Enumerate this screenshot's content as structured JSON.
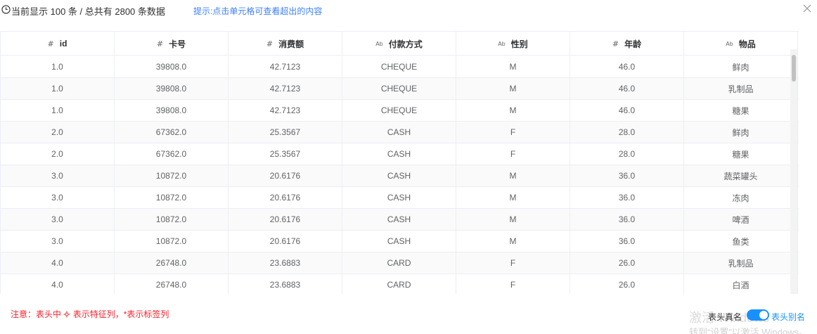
{
  "topbar": {
    "summary": "当前显示 100 条 / 总共有 2800 条数据",
    "hint": "提示:点击单元格可查看超出的内容"
  },
  "table": {
    "columns": [
      {
        "type_icon": "#",
        "label": "id"
      },
      {
        "type_icon": "#",
        "label": "卡号"
      },
      {
        "type_icon": "#",
        "label": "消费额"
      },
      {
        "type_icon": "Ab",
        "label": "付款方式"
      },
      {
        "type_icon": "Ab",
        "label": "性别"
      },
      {
        "type_icon": "#",
        "label": "年龄"
      },
      {
        "type_icon": "Ab",
        "label": "物品"
      }
    ],
    "rows": [
      [
        "1.0",
        "39808.0",
        "42.7123",
        "CHEQUE",
        "M",
        "46.0",
        "鲜肉"
      ],
      [
        "1.0",
        "39808.0",
        "42.7123",
        "CHEQUE",
        "M",
        "46.0",
        "乳制品"
      ],
      [
        "1.0",
        "39808.0",
        "42.7123",
        "CHEQUE",
        "M",
        "46.0",
        "糖果"
      ],
      [
        "2.0",
        "67362.0",
        "25.3567",
        "CASH",
        "F",
        "28.0",
        "鲜肉"
      ],
      [
        "2.0",
        "67362.0",
        "25.3567",
        "CASH",
        "F",
        "28.0",
        "糖果"
      ],
      [
        "3.0",
        "10872.0",
        "20.6176",
        "CASH",
        "M",
        "36.0",
        "蔬菜罐头"
      ],
      [
        "3.0",
        "10872.0",
        "20.6176",
        "CASH",
        "M",
        "36.0",
        "冻肉"
      ],
      [
        "3.0",
        "10872.0",
        "20.6176",
        "CASH",
        "M",
        "36.0",
        "啤酒"
      ],
      [
        "3.0",
        "10872.0",
        "20.6176",
        "CASH",
        "M",
        "36.0",
        "鱼类"
      ],
      [
        "4.0",
        "26748.0",
        "23.6883",
        "CARD",
        "F",
        "26.0",
        "乳制品"
      ],
      [
        "4.0",
        "26748.0",
        "23.6883",
        "CARD",
        "F",
        "26.0",
        "白酒"
      ]
    ]
  },
  "footer": {
    "note_prefix": "注意：表头中",
    "note_suffix": "表示特征列，*表示标签列",
    "label_left": "表头真名",
    "label_right": "表头别名",
    "toggle_on": true
  },
  "watermark": {
    "line1": "激活 Windows",
    "line2": "转到“设置”以激活 Windows。"
  },
  "colors": {
    "accent": "#1890ff",
    "hint": "#3d7fff",
    "note": "#f5222d"
  }
}
